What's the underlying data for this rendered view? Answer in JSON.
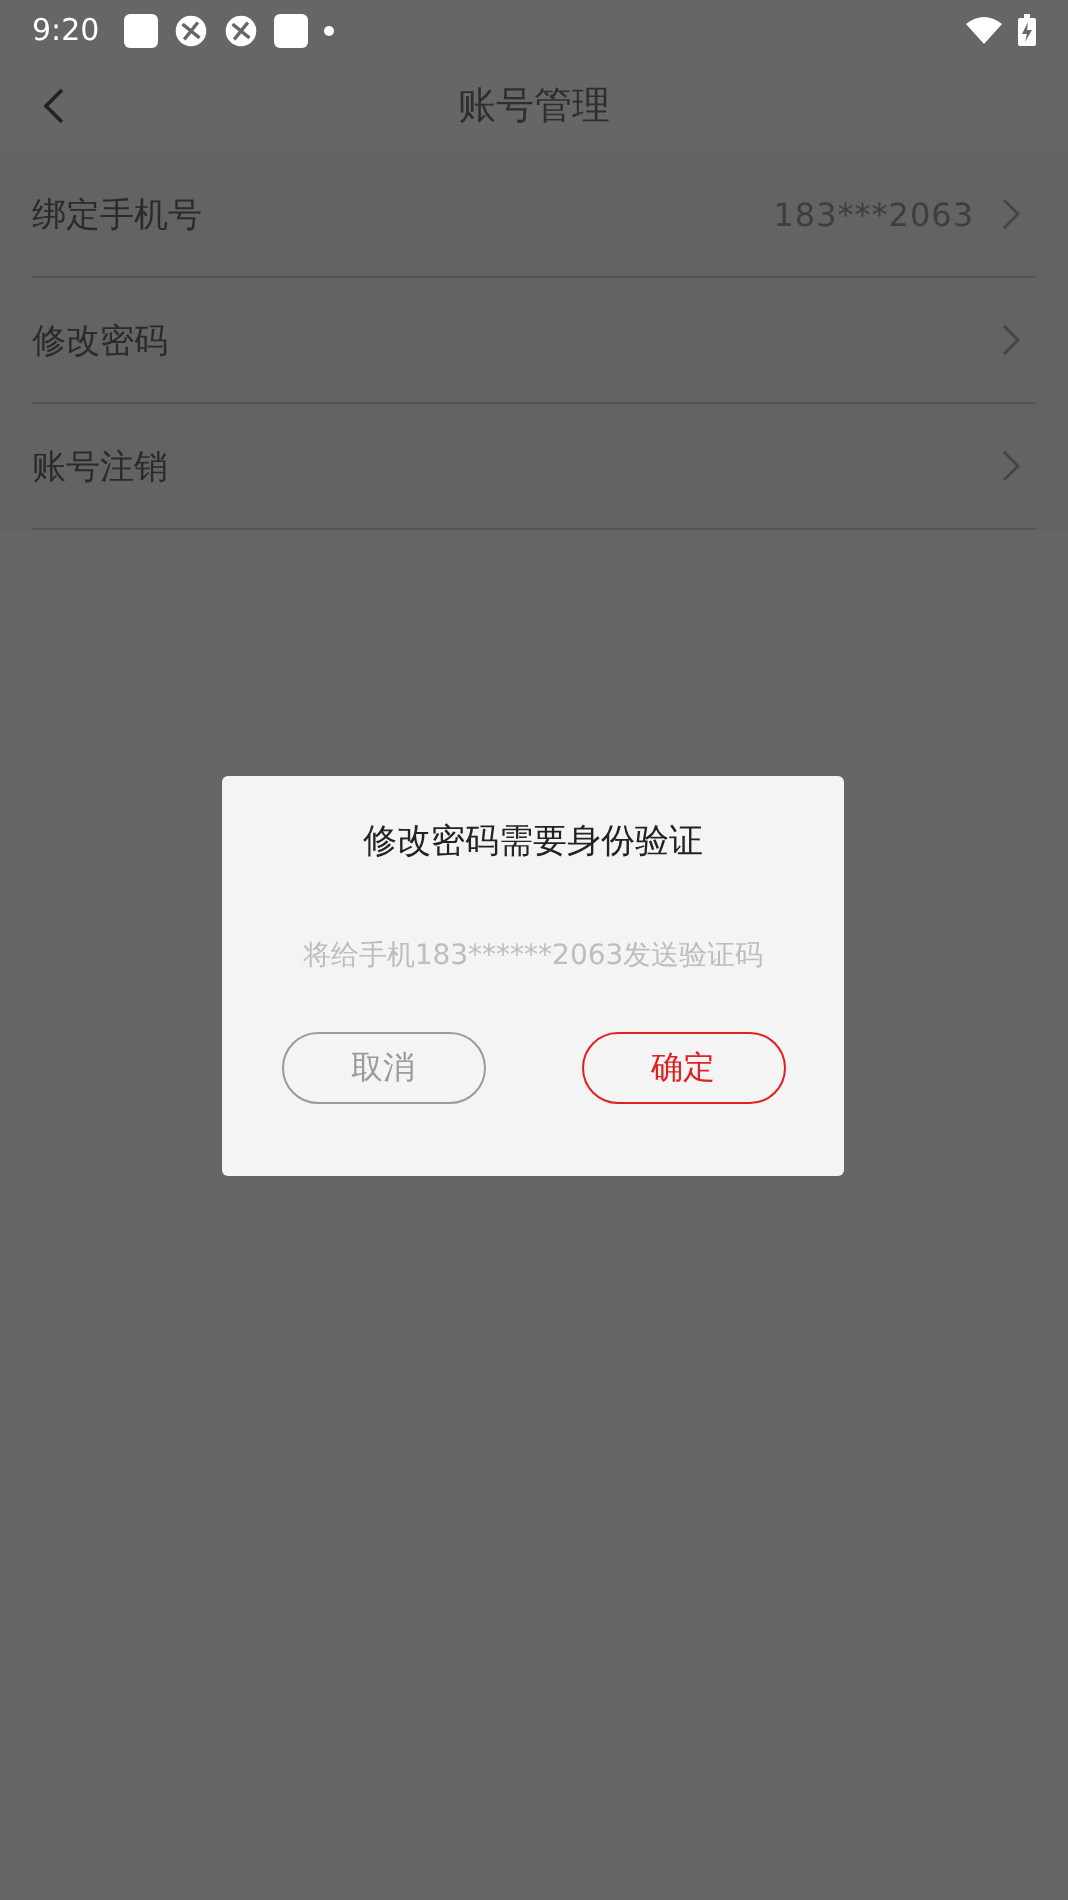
{
  "status_bar": {
    "time": "9:20"
  },
  "header": {
    "title": "账号管理"
  },
  "settings": [
    {
      "label": "绑定手机号",
      "value": "183***2063"
    },
    {
      "label": "修改密码"
    },
    {
      "label": "账号注销"
    }
  ],
  "dialog": {
    "title": "修改密码需要身份验证",
    "message": "将给手机183******2063发送验证码",
    "buttons": [
      {
        "label": "取消",
        "kind": "cancel"
      },
      {
        "label": "确定",
        "kind": "confirm"
      }
    ]
  }
}
